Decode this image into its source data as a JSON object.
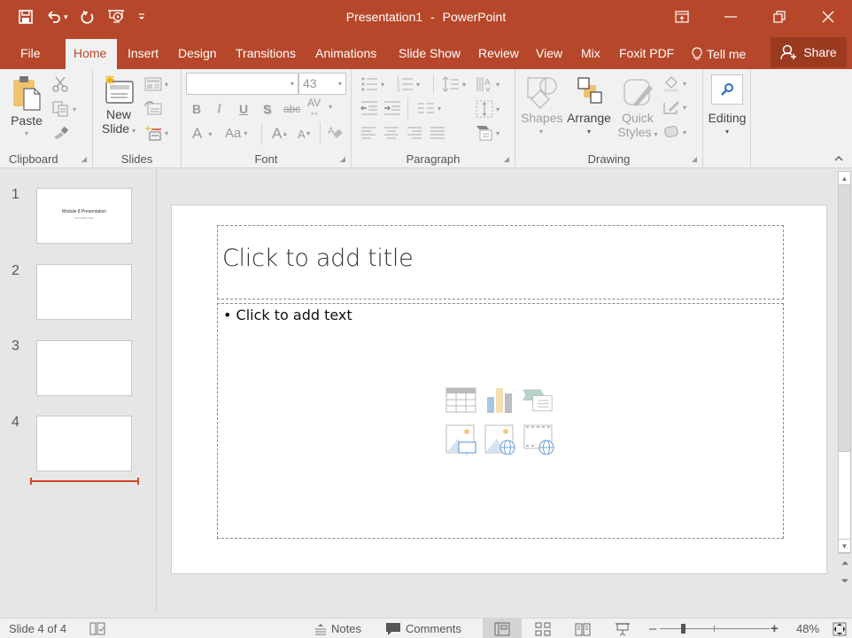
{
  "app": {
    "document_title": "Presentation1",
    "separator": "-",
    "app_name": "PowerPoint",
    "accent_color": "#b7472a"
  },
  "quick_access": {
    "save_icon": "save-icon",
    "undo_icon": "undo-icon",
    "redo_icon": "repeat-icon",
    "present_icon": "start-from-beginning-icon",
    "customize_icon": "customize-qat-icon"
  },
  "window_controls": {
    "ribbon_display": "ribbon-display-options-icon",
    "minimize": "minimize-icon",
    "restore": "restore-icon",
    "close": "close-icon"
  },
  "tabs": [
    {
      "label": "File",
      "active": false
    },
    {
      "label": "Home",
      "active": true
    },
    {
      "label": "Insert",
      "active": false
    },
    {
      "label": "Design",
      "active": false
    },
    {
      "label": "Transitions",
      "active": false
    },
    {
      "label": "Animations",
      "active": false
    },
    {
      "label": "Slide Show",
      "active": false
    },
    {
      "label": "Review",
      "active": false
    },
    {
      "label": "View",
      "active": false
    },
    {
      "label": "Mix",
      "active": false
    },
    {
      "label": "Foxit PDF",
      "active": false
    }
  ],
  "tell_me": "Tell me",
  "share": "Share",
  "ribbon": {
    "clipboard": {
      "label": "Clipboard",
      "paste": "Paste"
    },
    "slides": {
      "label": "Slides",
      "new_slide_line1": "New",
      "new_slide_line2": "Slide"
    },
    "font": {
      "label": "Font",
      "font_name": "",
      "font_size": "43",
      "bold": "B",
      "italic": "I",
      "underline": "U",
      "shadow": "S",
      "strikethrough": "abc",
      "spacing": "AV",
      "font_color": "A",
      "change_case": "Aa",
      "grow": "A",
      "shrink": "A"
    },
    "paragraph": {
      "label": "Paragraph"
    },
    "drawing": {
      "label": "Drawing",
      "shapes": "Shapes",
      "arrange": "Arrange",
      "quick_styles_line1": "Quick",
      "quick_styles_line2": "Styles"
    },
    "editing": {
      "label": "Editing"
    }
  },
  "thumbnails": [
    {
      "number": "1",
      "title": "Module 8 Presentation",
      "subtitle": "Your Name Here"
    },
    {
      "number": "2",
      "title": "",
      "subtitle": ""
    },
    {
      "number": "3",
      "title": "",
      "subtitle": ""
    },
    {
      "number": "4",
      "title": "",
      "subtitle": ""
    }
  ],
  "slide": {
    "title_placeholder": "Click to add title",
    "body_placeholder": "• Click to add text",
    "content_icons": [
      "insert-table-icon",
      "insert-chart-icon",
      "insert-smartart-icon",
      "pictures-icon",
      "online-pictures-icon",
      "insert-video-icon"
    ]
  },
  "status": {
    "slide_info": "Slide 4 of 4",
    "notes": "Notes",
    "comments": "Comments",
    "zoom_percent": "48%",
    "zoom_value": 48
  }
}
